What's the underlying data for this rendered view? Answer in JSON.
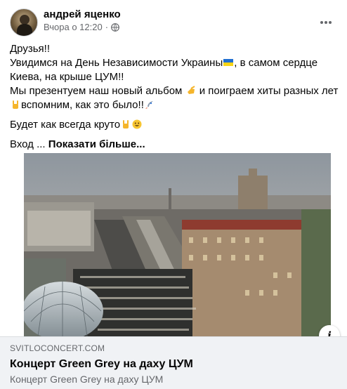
{
  "post": {
    "author": "андрей яценко",
    "time": "Вчора о 12:20",
    "separator": "·",
    "lines": [
      "Друзья!!",
      "Увидимся на День Независимости Украины",
      ", в самом сердце",
      "Киева, на крыше ЦУМ!!",
      "Мы презентуем наш новый альбом",
      " и поиграем хиты разных лет",
      "вспомним, как это было!!",
      "Будет как всегда круто",
      "Вход ... ",
      "Показати більше..."
    ]
  },
  "icons": {
    "privacy": "globe-icon",
    "more": "more-options-icon",
    "flag": "ukraine-flag-emoji",
    "hand": "pointing-hand-emoji",
    "rock": "rock-hand-emoji",
    "rocket": "rocket-emoji",
    "smile": "smile-emoji",
    "info": "i"
  },
  "link": {
    "domain": "SVITLOCONCERT.COM",
    "title": "Концерт Green Grey на даху ЦУМ",
    "description": "Концерт Green Grey на даху ЦУМ"
  },
  "colors": {
    "text": "#050505",
    "secondary": "#65676b",
    "card_bg": "#f0f2f5"
  }
}
